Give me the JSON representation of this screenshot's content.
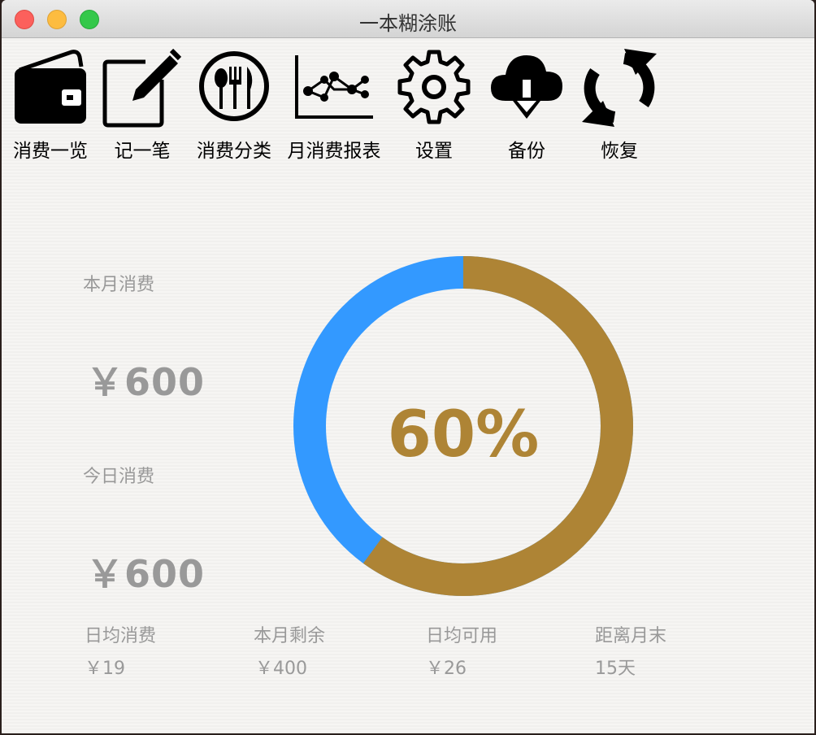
{
  "window": {
    "title": "一本糊涂账"
  },
  "toolbar": {
    "items": [
      {
        "label": "消费一览",
        "icon": "wallet-icon"
      },
      {
        "label": "记一笔",
        "icon": "edit-icon"
      },
      {
        "label": "消费分类",
        "icon": "dining-icon"
      },
      {
        "label": "月消费报表",
        "icon": "chart-icon"
      },
      {
        "label": "设置",
        "icon": "gear-icon"
      },
      {
        "label": "备份",
        "icon": "cloud-download-icon"
      },
      {
        "label": "恢复",
        "icon": "refresh-icon"
      }
    ]
  },
  "summary": {
    "month_label": "本月消费",
    "month_value": "￥600",
    "today_label": "今日消费",
    "today_value": "￥600"
  },
  "progress": {
    "percent_text": "60%",
    "fraction": 0.6,
    "used_color": "#ae8435",
    "remaining_color": "#3399ff"
  },
  "stats": [
    {
      "label": "日均消费",
      "value": "￥19"
    },
    {
      "label": "本月剩余",
      "value": "￥400"
    },
    {
      "label": "日均可用",
      "value": "￥26"
    },
    {
      "label": "距离月末",
      "value": "15天"
    }
  ]
}
